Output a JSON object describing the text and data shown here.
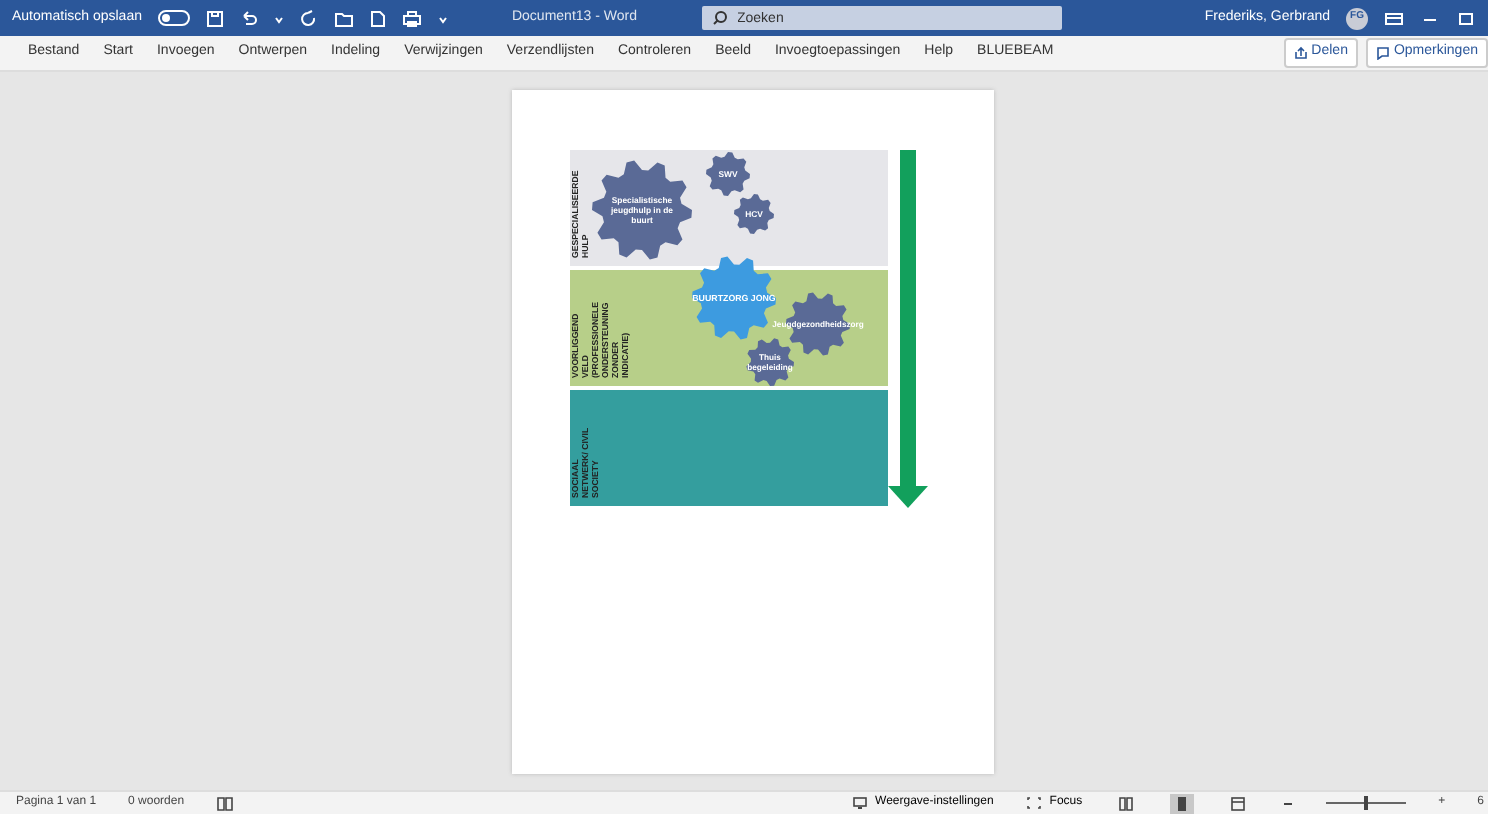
{
  "title_bar": {
    "autosave_label": "Automatisch opslaan",
    "autosave_on": false,
    "document_title": "Document13 - Word",
    "search": {
      "placeholder": "Zoeken"
    },
    "user_name": "Frederiks, Gerbrand",
    "user_initials": "FG"
  },
  "ribbon_tabs": [
    {
      "label": "Bestand",
      "selected": false
    },
    {
      "label": "Start",
      "selected": false
    },
    {
      "label": "Invoegen",
      "selected": false
    },
    {
      "label": "Ontwerpen",
      "selected": false
    },
    {
      "label": "Indeling",
      "selected": false
    },
    {
      "label": "Verwijzingen",
      "selected": false
    },
    {
      "label": "Verzendlijsten",
      "selected": false
    },
    {
      "label": "Controleren",
      "selected": false
    },
    {
      "label": "Beeld",
      "selected": false
    },
    {
      "label": "Invoegtoepassingen",
      "selected": false
    },
    {
      "label": "Help",
      "selected": false
    },
    {
      "label": "BLUEBEAM",
      "selected": false
    }
  ],
  "share_button": "Delen",
  "comments_button": "Opmerkingen",
  "diagram": {
    "bands": [
      {
        "label": "GESPECIALISEERDE HULP",
        "color": "#e6e6ea"
      },
      {
        "label": "VOORLIGGEND VELD (PROFESSIONELE ONDERSTEUNING ZONDER INDICATIE)",
        "color": "#b7cf89"
      },
      {
        "label": "SOCIAAL NETWERK/ CIVIL SOCIETY",
        "color": "#349e9e"
      }
    ],
    "gears": [
      {
        "label": "Specialistische jeugdhulp in de buurt",
        "color": "#5a6a96"
      },
      {
        "label": "SWV",
        "color": "#5a6a96"
      },
      {
        "label": "HCV",
        "color": "#5a6a96"
      },
      {
        "label": "BUURTZORG JONG",
        "color": "#3d9be0"
      },
      {
        "label": "Jeugdgezondheidszorg",
        "color": "#5a6a96"
      },
      {
        "label": "Thuis begeleiding",
        "color": "#5a6a96"
      }
    ]
  },
  "status_bar": {
    "page": "Pagina 1 van 1",
    "words": "0 woorden",
    "display_settings": "Weergave-instellingen",
    "focus": "Focus",
    "views": [
      {
        "selected": false
      },
      {
        "selected": true
      },
      {
        "selected": false
      }
    ],
    "zoom": {
      "level": 0.5
    },
    "zoom_plus": "+",
    "zoom_value": "6"
  }
}
